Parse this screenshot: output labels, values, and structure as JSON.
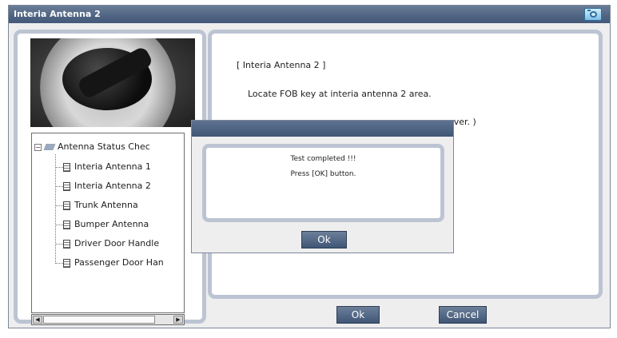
{
  "window": {
    "title": "Interia Antenna 2",
    "icon": "camera-icon"
  },
  "tree": {
    "root_label": "Antenna Status Chec",
    "items": [
      {
        "label": "Interia Antenna 1"
      },
      {
        "label": "Interia Antenna 2"
      },
      {
        "label": "Trunk Antenna"
      },
      {
        "label": "Bumper Antenna"
      },
      {
        "label": "Driver Door Handle"
      },
      {
        "label": "Passenger Door Han"
      }
    ]
  },
  "instructions": {
    "line1": "[ Interia Antenna 2 ]",
    "line2": "Locate FOB key at interia antenna 2 area.",
    "line3_visible_tail": "over. )"
  },
  "buttons": {
    "ok": "Ok",
    "cancel": "Cancel"
  },
  "dialog": {
    "message1": "Test completed !!!",
    "message2": "Press [OK] button.",
    "ok": "Ok"
  },
  "colors": {
    "titlebar": "#4f6482",
    "panel_border": "#bcc4d3",
    "button": "#405676"
  }
}
